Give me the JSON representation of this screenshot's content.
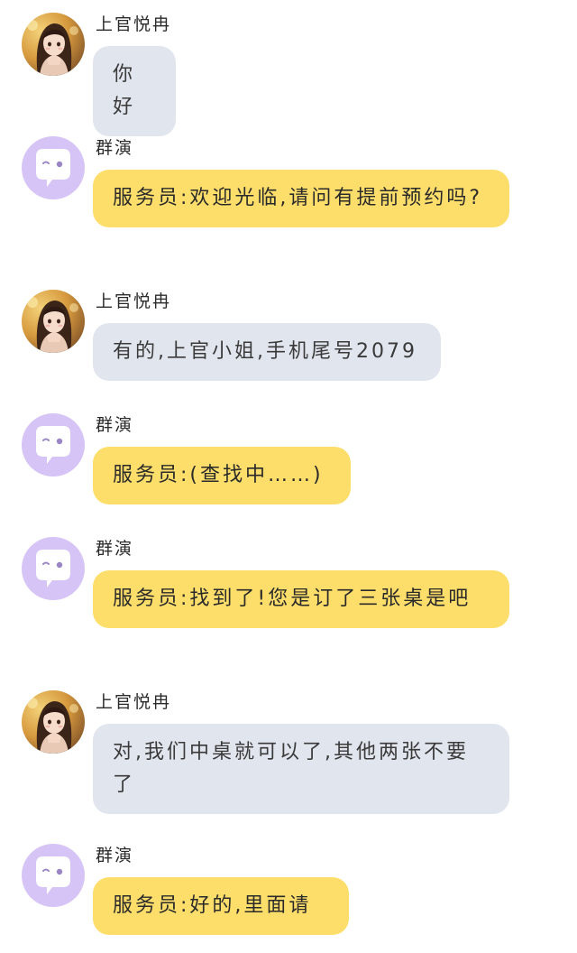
{
  "messages": [
    {
      "speaker": "上官悦冉",
      "role": "protagonist",
      "avatar_icon": "girl-portrait-avatar-icon",
      "text": "你好"
    },
    {
      "speaker": "群演",
      "role": "extra",
      "avatar_icon": "chat-bubble-avatar-icon",
      "text": "服务员:欢迎光临,请问有提前预约吗?"
    },
    {
      "speaker": "上官悦冉",
      "role": "protagonist",
      "avatar_icon": "girl-portrait-avatar-icon",
      "text": "有的,上官小姐,手机尾号2079"
    },
    {
      "speaker": "群演",
      "role": "extra",
      "avatar_icon": "chat-bubble-avatar-icon",
      "text": "服务员:(查找中……)"
    },
    {
      "speaker": "群演",
      "role": "extra",
      "avatar_icon": "chat-bubble-avatar-icon",
      "text": "服务员:找到了!您是订了三张桌是吧"
    },
    {
      "speaker": "上官悦冉",
      "role": "protagonist",
      "avatar_icon": "girl-portrait-avatar-icon",
      "text": "对,我们中桌就可以了,其他两张不要了"
    },
    {
      "speaker": "群演",
      "role": "extra",
      "avatar_icon": "chat-bubble-avatar-icon",
      "text": "服务员:好的,里面请"
    }
  ],
  "colors": {
    "protagonist_bubble": "#e1e5ee",
    "extra_bubble": "#fede6b",
    "extra_avatar_bg": "#d6c4f6",
    "background": "#ffffff"
  }
}
